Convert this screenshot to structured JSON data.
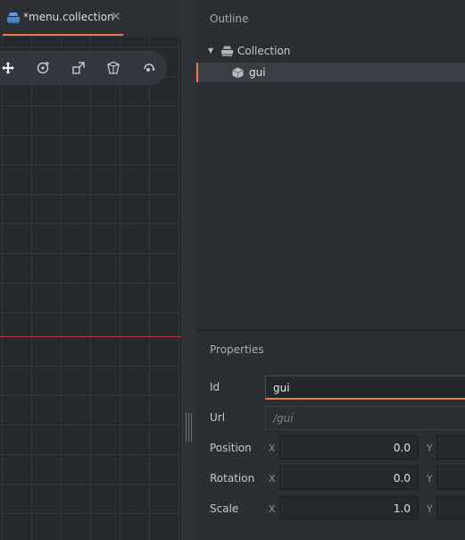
{
  "editor": {
    "tab": {
      "label": "*menu.collection",
      "close_glyph": "✕"
    },
    "toolbar": {
      "tools": [
        {
          "icon": "move-icon",
          "active": true
        },
        {
          "icon": "rotate-icon"
        },
        {
          "icon": "scale-icon"
        },
        {
          "icon": "perspective-icon"
        },
        {
          "icon": "camera-reset-icon"
        }
      ]
    }
  },
  "outline": {
    "title": "Outline",
    "root": {
      "label": "Collection",
      "icon": "collection-icon",
      "expanded": true
    },
    "children": [
      {
        "label": "gui",
        "icon": "gui-component-icon",
        "selected": true
      }
    ]
  },
  "properties": {
    "title": "Properties",
    "id": {
      "label": "Id",
      "value": "gui"
    },
    "url": {
      "label": "Url",
      "value": "/gui"
    },
    "position": {
      "label": "Position",
      "x_axis": "X",
      "x_value": "0.0",
      "y_axis": "Y"
    },
    "rotation": {
      "label": "Rotation",
      "x_axis": "X",
      "x_value": "0.0",
      "y_axis": "Y"
    },
    "scale": {
      "label": "Scale",
      "x_axis": "X",
      "x_value": "1.0",
      "y_axis": "Y"
    }
  },
  "colors": {
    "accent": "#ef7a4a",
    "background": "#2b2e33",
    "viewport": "#25282c"
  }
}
